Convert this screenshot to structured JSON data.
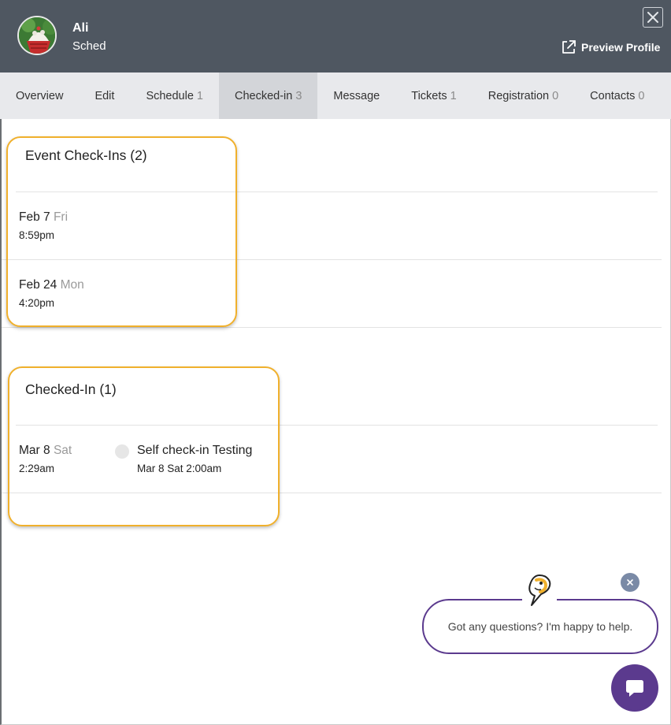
{
  "header": {
    "user_name": "Ali",
    "user_subtitle": "Sched",
    "preview_label": "Preview Profile"
  },
  "tabs": [
    {
      "label": "Overview",
      "count": ""
    },
    {
      "label": "Edit",
      "count": ""
    },
    {
      "label": "Schedule",
      "count": "1"
    },
    {
      "label": "Checked-in",
      "count": "3",
      "active": true
    },
    {
      "label": "Message",
      "count": ""
    },
    {
      "label": "Tickets",
      "count": "1"
    },
    {
      "label": "Registration",
      "count": "0"
    },
    {
      "label": "Contacts",
      "count": "0"
    }
  ],
  "event_checkins": {
    "title": "Event Check-Ins (2)",
    "rows": [
      {
        "date": "Feb 7",
        "dow": "Fri",
        "time": "8:59pm"
      },
      {
        "date": "Feb 24",
        "dow": "Mon",
        "time": "4:20pm"
      }
    ]
  },
  "checked_in": {
    "title": "Checked-In (1)",
    "rows": [
      {
        "date": "Mar 8",
        "dow": "Sat",
        "time": "2:29am",
        "event_name": "Self check-in Testing",
        "event_time": "Mar 8 Sat 2:00am"
      }
    ]
  },
  "chat": {
    "message": "Got any questions? I'm happy to help."
  },
  "colors": {
    "header_bg": "#4f5761",
    "tab_bg": "#e8e9ec",
    "tab_active_bg": "#d3d5d9",
    "highlight": "#f0b02c",
    "chat_purple": "#5b3a8e"
  }
}
